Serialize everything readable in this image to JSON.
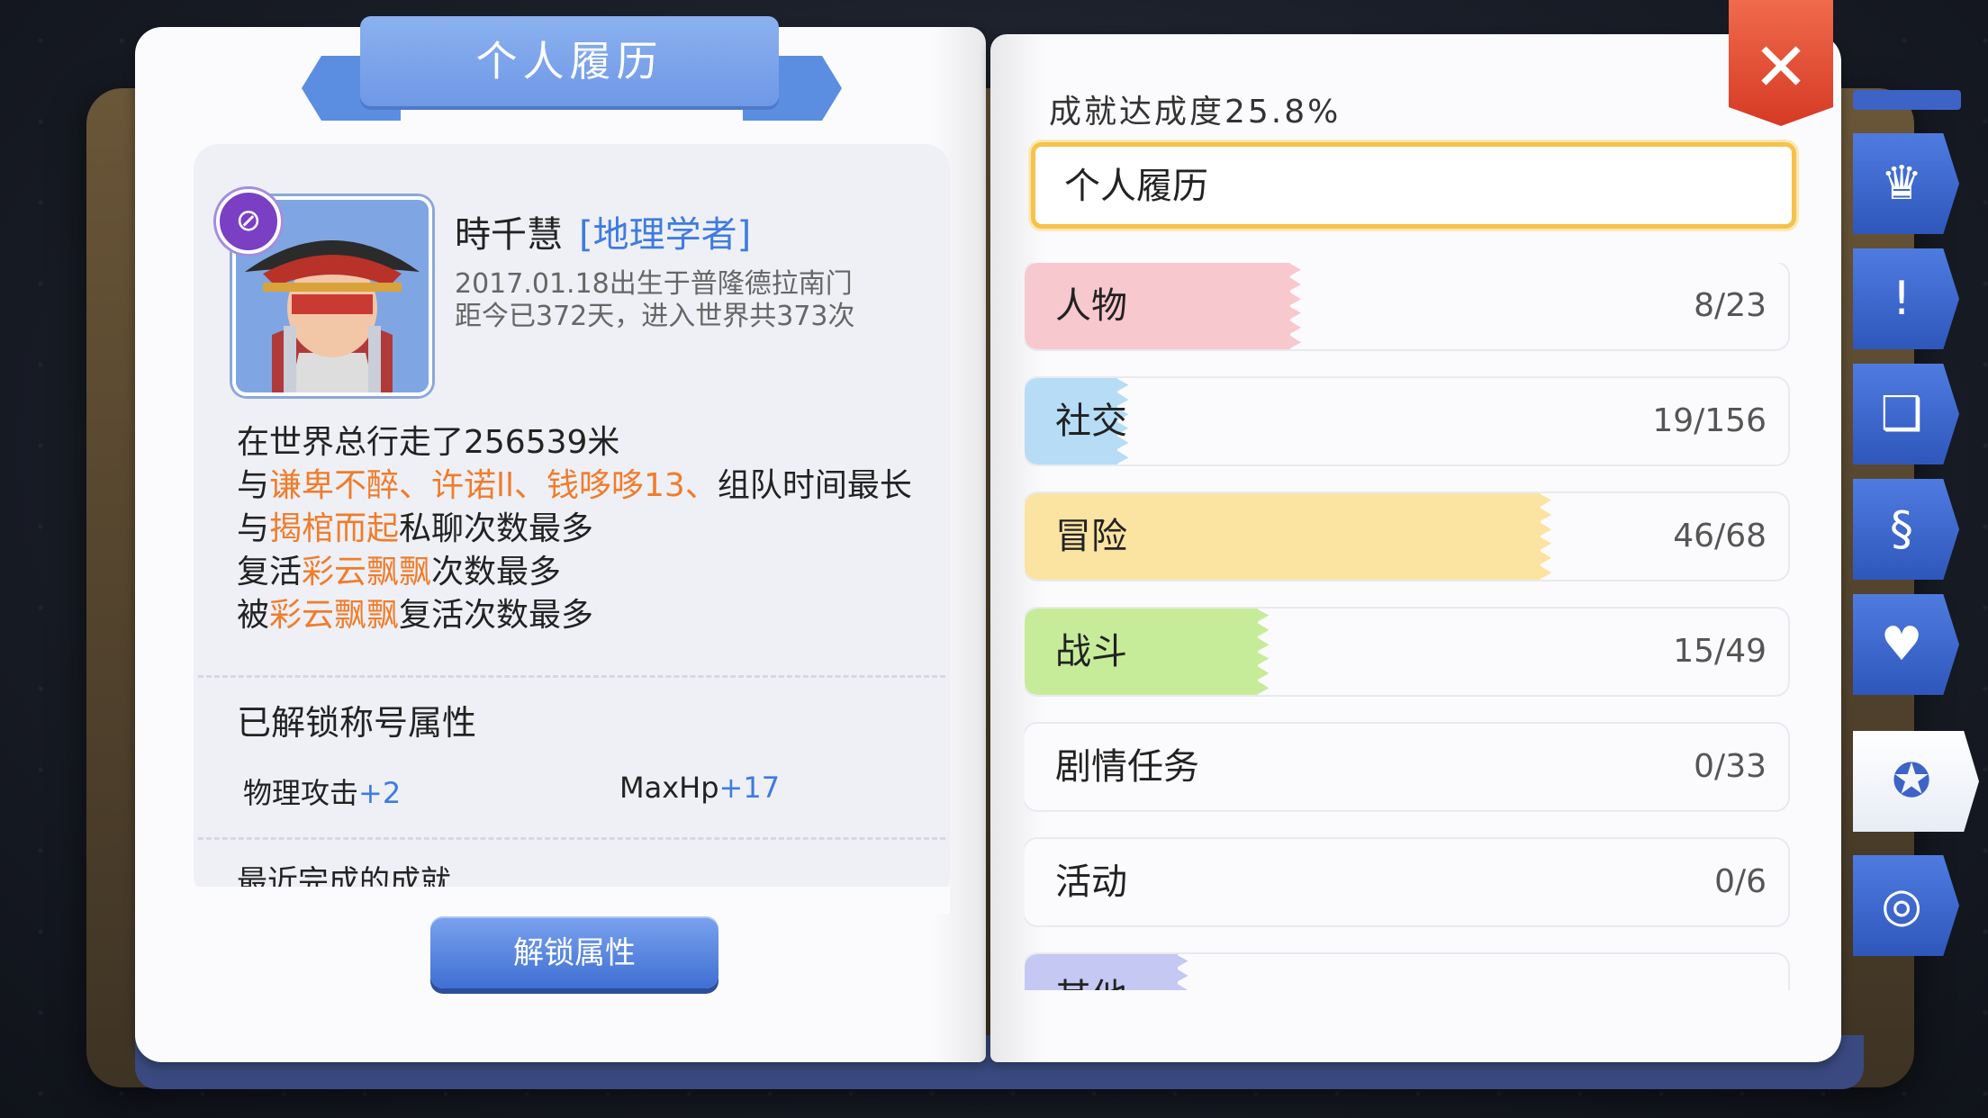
{
  "left_page": {
    "title": "个人履历",
    "badge_icon": "compass-emblem-icon",
    "character": {
      "name": "時千慧",
      "job": "[地理学者]",
      "birth": "2017.01.18出生于普隆德拉南门",
      "days": "距今已372天，进入世界共373次"
    },
    "stats": {
      "walk": "在世界总行走了256539米",
      "team_pre": "与",
      "team_names": "谦卑不醉、许诺ll、钱哆哆13、",
      "team_post": "组队时间最长",
      "chat_pre": "与",
      "chat_name": "揭棺而起",
      "chat_post": "私聊次数最多",
      "revive_pre": "复活",
      "revive_name": "彩云飘飘",
      "revive_post": "次数最多",
      "revived_pre": "被",
      "revived_name": "彩云飘飘",
      "revived_post": "复活次数最多"
    },
    "unlocked_title": "已解锁称号属性",
    "attrs": [
      {
        "name": "物理攻击",
        "plus": "+2"
      },
      {
        "name": "MaxHp",
        "plus": "+17"
      }
    ],
    "recent_title": "最近完成的成就",
    "unlock_button": "解锁属性"
  },
  "right_page": {
    "achievement_rate": "成就达成度25.8%",
    "current_tab": "个人履历",
    "categories": [
      {
        "label": "人物",
        "count": "8/23",
        "progress": 0.348,
        "color": "#f8c8cf"
      },
      {
        "label": "社交",
        "count": "19/156",
        "progress": 0.122,
        "color": "#b6dcf6"
      },
      {
        "label": "冒险",
        "count": "46/68",
        "progress": 0.676,
        "color": "#fbe3a2"
      },
      {
        "label": "战斗",
        "count": "15/49",
        "progress": 0.306,
        "color": "#c6ec9a"
      },
      {
        "label": "剧情任务",
        "count": "0/33",
        "progress": 0,
        "color": "#ffffff"
      },
      {
        "label": "活动",
        "count": "0/6",
        "progress": 0,
        "color": "#ffffff"
      },
      {
        "label": "其他",
        "count": "",
        "progress": 0.2,
        "color": "#c5c8f2"
      }
    ]
  },
  "close_label": "✕",
  "side_tabs": [
    {
      "icon": "chef-hat-icon",
      "glyph": "♛",
      "active": false
    },
    {
      "icon": "alert-person-icon",
      "glyph": "!",
      "active": false
    },
    {
      "icon": "open-book-icon",
      "glyph": "❑",
      "active": false
    },
    {
      "icon": "card-icon",
      "glyph": "§",
      "active": false
    },
    {
      "icon": "briefcase-heart-icon",
      "glyph": "♥",
      "active": false
    },
    {
      "icon": "medal-icon",
      "glyph": "✪",
      "active": true
    },
    {
      "icon": "target-icon",
      "glyph": "◎",
      "active": false
    }
  ]
}
